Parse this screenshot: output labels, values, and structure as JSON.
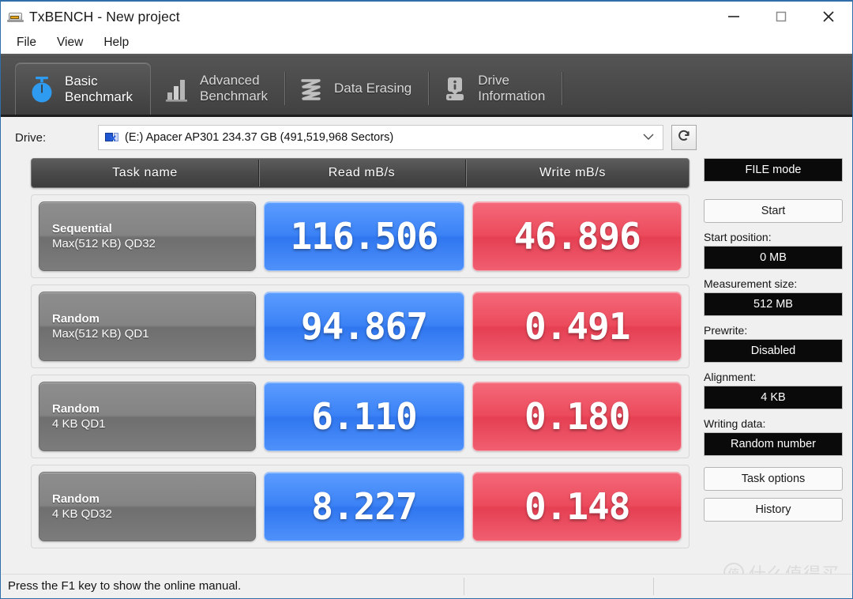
{
  "window": {
    "title": "TxBENCH - New project",
    "icon": "drive-app-icon",
    "controls": {
      "minimize": "minimize-icon",
      "maximize": "maximize-icon",
      "close": "close-icon"
    }
  },
  "menu": {
    "items": [
      {
        "label": "File"
      },
      {
        "label": "View"
      },
      {
        "label": "Help"
      }
    ]
  },
  "tabs": [
    {
      "label": "Basic\nBenchmark",
      "icon": "stopwatch-icon",
      "active": true
    },
    {
      "label": "Advanced\nBenchmark",
      "icon": "bar-chart-icon",
      "active": false
    },
    {
      "label": "Data Erasing",
      "icon": "eraser-wave-icon",
      "active": false
    },
    {
      "label": "Drive\nInformation",
      "icon": "drive-info-icon",
      "active": false
    }
  ],
  "drive": {
    "label": "Drive:",
    "selected": "(E:) Apacer AP301  234.37 GB (491,519,968 Sectors)",
    "icon": "drive-select-icon",
    "caret": "chevron-down-icon",
    "refresh_icon": "refresh-icon"
  },
  "benchmark": {
    "columns": [
      "Task name",
      "Read mB/s",
      "Write mB/s"
    ],
    "rows": [
      {
        "task_line1": "Sequential",
        "task_line2": "Max(512 KB) QD32",
        "read": "116.506",
        "write": "46.896"
      },
      {
        "task_line1": "Random",
        "task_line2": "Max(512 KB) QD1",
        "read": "94.867",
        "write": "0.491"
      },
      {
        "task_line1": "Random",
        "task_line2": "4 KB QD1",
        "read": "6.110",
        "write": "0.180"
      },
      {
        "task_line1": "Random",
        "task_line2": "4 KB QD32",
        "read": "8.227",
        "write": "0.148"
      }
    ]
  },
  "sidebar": {
    "mode": "FILE mode",
    "start_button": "Start",
    "fields": [
      {
        "label": "Start position:",
        "value": "0 MB"
      },
      {
        "label": "Measurement size:",
        "value": "512 MB"
      },
      {
        "label": "Prewrite:",
        "value": "Disabled"
      },
      {
        "label": "Alignment:",
        "value": "4 KB"
      },
      {
        "label": "Writing data:",
        "value": "Random number"
      }
    ],
    "task_options_button": "Task options",
    "history_button": "History"
  },
  "statusbar": {
    "message": "Press the F1 key to show the online manual."
  },
  "watermark": {
    "mark": "值",
    "text": "什么值得买"
  },
  "colors": {
    "read_accent": "#3b82f6",
    "write_accent": "#ec4b5c",
    "tabstrip_bg": "#4a4a4a",
    "window_border": "#2f6ea8"
  }
}
